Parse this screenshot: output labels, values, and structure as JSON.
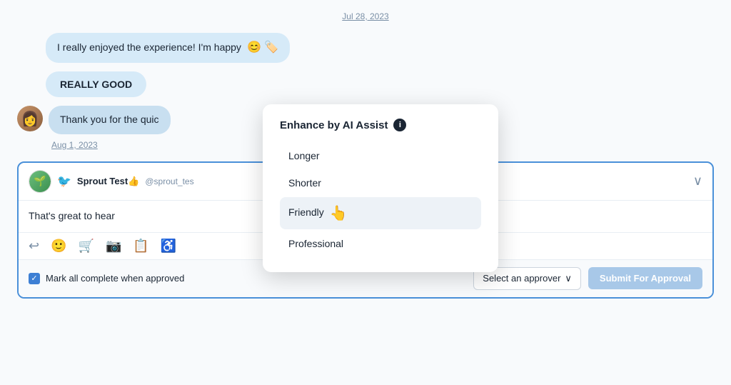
{
  "chat": {
    "date1": "Jul 28, 2023",
    "message1": "I really enjoyed the experience! I'm happy",
    "message1_icons": [
      "😊",
      "🏷️"
    ],
    "message2": "REALLY GOOD",
    "date2": "Aug 1, 2023",
    "message3_partial": "Thank you for the quic",
    "reply_username": "Sprout Test👍",
    "reply_handle": "@sprout_tes",
    "reply_text": "That's great to hear",
    "collapse_icon": "∨",
    "mark_complete_label": "Mark all complete when approved",
    "select_approver_label": "Select an approver",
    "submit_label": "Submit For Approval"
  },
  "ai_popup": {
    "title": "Enhance by AI Assist",
    "info_icon": "i",
    "options": [
      {
        "id": "longer",
        "label": "Longer"
      },
      {
        "id": "shorter",
        "label": "Shorter"
      },
      {
        "id": "friendly",
        "label": "Friendly",
        "highlighted": true
      },
      {
        "id": "professional",
        "label": "Professional"
      }
    ]
  },
  "toolbar": {
    "icons": [
      "reply",
      "emoji",
      "cart",
      "camera",
      "clipboard",
      "accessibility"
    ]
  }
}
